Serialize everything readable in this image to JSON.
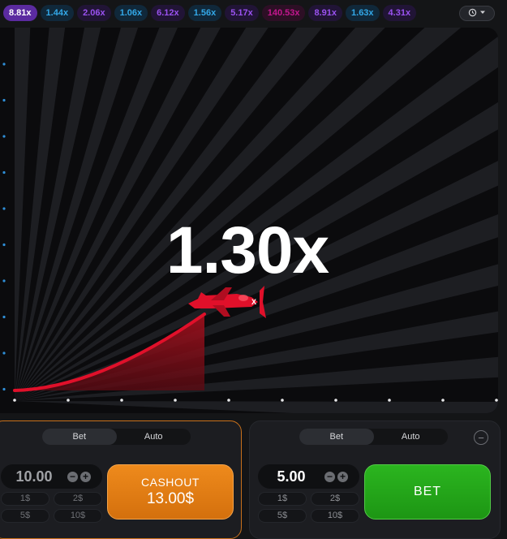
{
  "history": {
    "multipliers": [
      {
        "value": "8.81x",
        "tone": "first"
      },
      {
        "value": "1.44x",
        "tone": "blue"
      },
      {
        "value": "2.06x",
        "tone": "purple"
      },
      {
        "value": "1.06x",
        "tone": "blue"
      },
      {
        "value": "6.12x",
        "tone": "purple"
      },
      {
        "value": "1.56x",
        "tone": "blue"
      },
      {
        "value": "5.17x",
        "tone": "purple"
      },
      {
        "value": "140.53x",
        "tone": "magenta"
      },
      {
        "value": "8.91x",
        "tone": "purple"
      },
      {
        "value": "1.63x",
        "tone": "blue"
      },
      {
        "value": "4.31x",
        "tone": "purple"
      }
    ],
    "history_icon": "history-icon",
    "dropdown_icon": "chevron-down-icon"
  },
  "game": {
    "multiplier": "1.30x",
    "plane_icon": "airplane-icon"
  },
  "colors": {
    "accent_orange": "#e07d14",
    "accent_green": "#22a818",
    "curve_red": "#e0102a",
    "blue": "#33a8e8",
    "purple": "#9a52f0",
    "magenta": "#c3178f"
  },
  "bet_panels": [
    {
      "tabs": [
        "Bet",
        "Auto"
      ],
      "active_tab": "Bet",
      "stake": "10.00",
      "quick_amounts": [
        "1$",
        "2$",
        "5$",
        "10$"
      ],
      "action_line1": "CASHOUT",
      "action_line2": "13.00$"
    },
    {
      "tabs": [
        "Bet",
        "Auto"
      ],
      "active_tab": "Bet",
      "stake": "5.00",
      "quick_amounts": [
        "1$",
        "2$",
        "5$",
        "10$"
      ],
      "action_line1": "BET"
    }
  ]
}
